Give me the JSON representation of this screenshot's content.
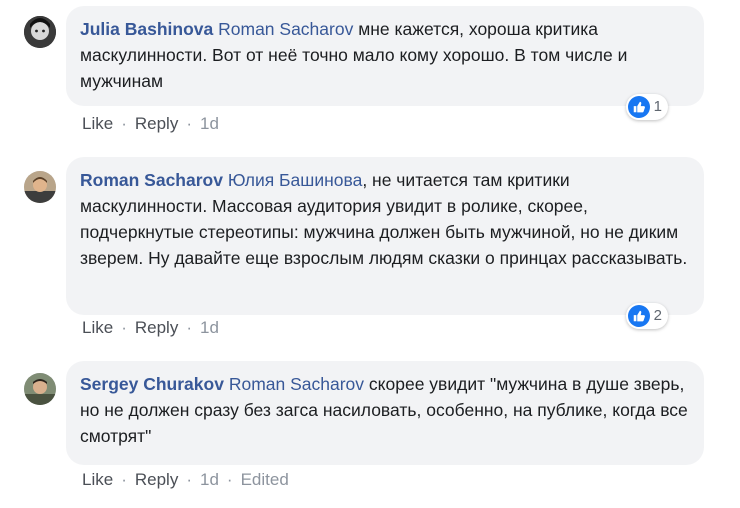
{
  "comments": [
    {
      "author": "Julia Bashinova",
      "mention": "Roman Sacharov",
      "text": " мне кажется, хороша критика маскулинности. Вот от неё точно мало кому хорошо. В том числе и мужчинам",
      "reactions": "1",
      "actions": {
        "like": "Like",
        "reply": "Reply",
        "time": "1d",
        "edited": ""
      }
    },
    {
      "author": "Roman Sacharov",
      "mention": "Юлия Башинова",
      "text": ", не читается там критики маскулинности. Массовая аудитория увидит в ролике, скорее, подчеркнутые стереотипы: мужчина должен быть мужчиной, но не диким зверем. Ну давайте еще взрослым людям сказки о принцах рассказывать.",
      "reactions": "2",
      "actions": {
        "like": "Like",
        "reply": "Reply",
        "time": "1d",
        "edited": ""
      }
    },
    {
      "author": "Sergey Churakov",
      "mention": "Roman Sacharov",
      "text": " скорее увидит \"мужчина в душе зверь, но не должен сразу без загса насиловать, особенно, на публике, когда все смотрят\"",
      "reactions": "",
      "actions": {
        "like": "Like",
        "reply": "Reply",
        "time": "1d",
        "edited": "Edited"
      }
    }
  ],
  "separator": "·",
  "colors": {
    "author": "#385898",
    "bubble": "#f2f3f5",
    "like_blue": "#1877f2"
  },
  "icons": {
    "reaction": "like-thumb-icon",
    "avatar": "user-avatar"
  }
}
